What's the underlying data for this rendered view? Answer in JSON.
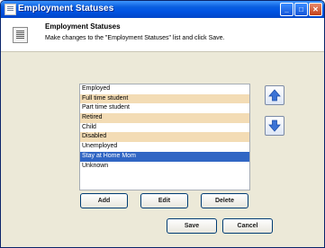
{
  "window": {
    "title": "Employment Statuses"
  },
  "header": {
    "title": "Employment Statuses",
    "description": "Make changes to the \"Employment Statuses\" list and click Save."
  },
  "list": {
    "items": [
      {
        "label": "Employed",
        "style": "plain"
      },
      {
        "label": "Full time student",
        "style": "alt"
      },
      {
        "label": "Part time student",
        "style": "plain"
      },
      {
        "label": "Retired",
        "style": "alt"
      },
      {
        "label": "Child",
        "style": "plain"
      },
      {
        "label": "Disabled",
        "style": "alt"
      },
      {
        "label": "Unemployed",
        "style": "plain"
      },
      {
        "label": "Stay at Home Mom",
        "style": "selected"
      },
      {
        "label": "Unknown",
        "style": "plain"
      }
    ]
  },
  "buttons": {
    "add": "Add",
    "edit": "Edit",
    "delete": "Delete",
    "save": "Save",
    "cancel": "Cancel"
  },
  "icons": {
    "move_up": "arrow-up-icon",
    "move_down": "arrow-down-icon"
  },
  "colors": {
    "title_bar": "#0054e3",
    "alt_row": "#f3dcb5",
    "selected_row": "#3166c4",
    "arrow": "#3b73d6"
  }
}
